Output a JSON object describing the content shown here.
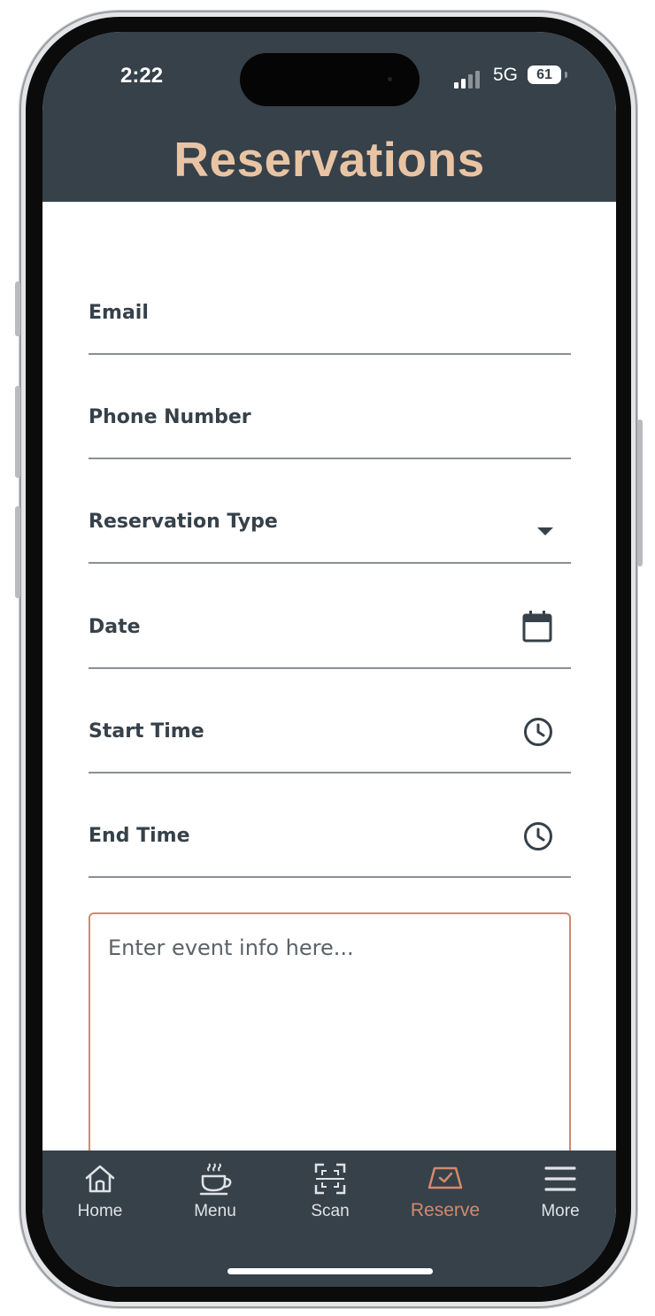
{
  "status_bar": {
    "time": "2:22",
    "network": "5G",
    "battery": "61"
  },
  "header": {
    "title": "Reservations"
  },
  "form": {
    "email_label": "Email",
    "phone_label": "Phone Number",
    "type_label": "Reservation Type",
    "date_label": "Date",
    "start_label": "Start Time",
    "end_label": "End Time",
    "event_info_placeholder": "Enter event info here..."
  },
  "tabs": [
    {
      "label": "Home",
      "icon": "house-icon"
    },
    {
      "label": "Menu",
      "icon": "coffee-cup-icon"
    },
    {
      "label": "Scan",
      "icon": "scan-icon"
    },
    {
      "label": "Reserve",
      "icon": "reserve-icon",
      "active": true
    },
    {
      "label": "More",
      "icon": "hamburger-icon"
    }
  ],
  "colors": {
    "header_bg": "#36414a",
    "title": "#e9c4a4",
    "accent": "#d4896b",
    "tab_inactive": "#dfe3e6"
  }
}
